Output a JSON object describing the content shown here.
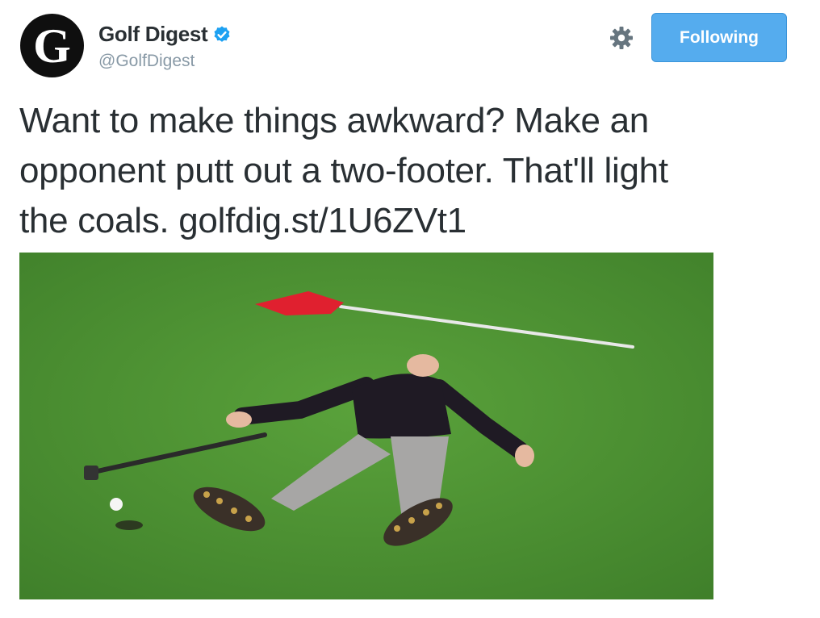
{
  "header": {
    "avatar_letter": "G",
    "display_name": "Golf Digest",
    "handle": "@GolfDigest",
    "verified_icon": "verified-badge-icon",
    "settings_icon": "gear-icon",
    "follow_button_label": "Following"
  },
  "tweet": {
    "text_line1": "Want to make things awkward? Make an",
    "text_line2": "opponent putt out a two-footer. That'll light",
    "text_line3_prefix": "the coals. ",
    "link_text": "golfdig.st/1U6ZVt1"
  },
  "media": {
    "description_icon": "photo-golfer-lying-on-green"
  },
  "colors": {
    "accent": "#55acee",
    "text": "#292f33",
    "muted": "#8899a6",
    "green": "#4f8f33",
    "flag": "#e0202f"
  }
}
